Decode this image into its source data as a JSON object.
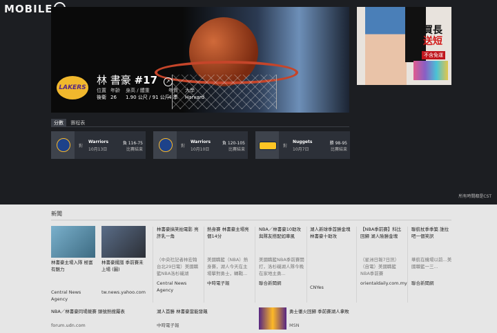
{
  "logo": {
    "text": "MOBILE"
  },
  "hero": {
    "team_logo_text": "LAKERS",
    "player_name": "林 書豪",
    "number": "#17",
    "stats": [
      {
        "label": "位置",
        "value": "後衛"
      },
      {
        "label": "年齡",
        "value": "26"
      },
      {
        "label": "身高 / 體重",
        "value": "1.90 公尺 / 91 公斤"
      },
      {
        "label": "年資",
        "value": "4 季"
      },
      {
        "label": "大學",
        "value": "Harvard"
      }
    ]
  },
  "ad": {
    "line1": "買長",
    "line2": "送短",
    "tag": "不含免運"
  },
  "tabs": [
    {
      "label": "分數"
    },
    {
      "label": "賽程表"
    }
  ],
  "games": [
    {
      "vs": "對",
      "team": "Warriors",
      "date": "10月13日",
      "score": "負 116-75",
      "status": "比賽結束"
    },
    {
      "vs": "對",
      "team": "Warriors",
      "date": "10月10日",
      "score": "負 120-105",
      "status": "比賽結束"
    },
    {
      "vs": "對",
      "team": "Nuggets",
      "date": "10月7日",
      "score": "勝 98-95",
      "status": "比賽結束"
    }
  ],
  "timezone_note": "所有時間都是CST",
  "news": {
    "title": "新聞",
    "items": [
      {
        "title": "林書豪主場入隊 極富有魅力",
        "summary": "",
        "source": "Central News Agency"
      },
      {
        "title": "林書豪擺譜 季前賽未上場 (圖)",
        "summary": "",
        "source": "tw.news.yahoo.com"
      },
      {
        "title": "林書豪搞笑拍電影 亮許乳一角",
        "summary": "（中央社記者林宏翰台北29日電）美國職籃NBA洛杉磯湖",
        "source": "Central News Agency"
      },
      {
        "title": "熱身賽 林書豪主場亮個14分",
        "summary": "美國職籃（NBA）熱身賽，湖人今天在主場擊對勇士，轉戰...",
        "source": "中時電子報"
      },
      {
        "title": "NBA／林書豪10助攻 與隊友搭配如車風",
        "summary": "美國職籃NBA季前賽開打，洛杉磯湖人隊今晚在家地主勇...",
        "source": "聯合新聞網"
      },
      {
        "title": "湖人新球季首勝金塊 林書豪十助攻",
        "summary": "",
        "source": "CNYes"
      },
      {
        "title": "【NBA季前賽】科比回歸 湖人險勝金塊",
        "summary": "（星洲日報7日訊）（自電）美國職籃NBA季前賽",
        "source": "orientaldaily.com.my"
      },
      {
        "title": "聯航杖季季築 誰拉吧一個笑訳",
        "summary": "華航在機場以前...美國職籃一三...",
        "source": "聯合新聞網"
      }
    ],
    "row2": [
      {
        "title": "NBA／林書豪同場競賽 頭號熱搜屬表",
        "source": "forum.udn.com"
      },
      {
        "title": "湖人首勝 林書豪當能發飆",
        "source": "中時電子報"
      },
      {
        "title": "勇士徹火回歸 季前賽湖人拿敗",
        "source": "MSN"
      }
    ]
  }
}
